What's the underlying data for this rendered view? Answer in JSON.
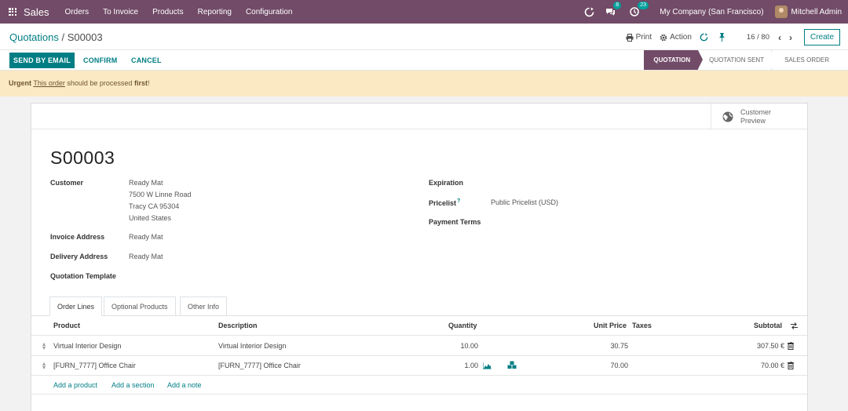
{
  "topbar": {
    "app_name": "Sales",
    "menu": [
      "Orders",
      "To Invoice",
      "Products",
      "Reporting",
      "Configuration"
    ],
    "messages_count": "8",
    "activities_count": "23",
    "company": "My Company (San Francisco)",
    "user": "Mitchell Admin"
  },
  "controlpanel": {
    "breadcrumb_parent": "Quotations",
    "breadcrumb_sep": "/",
    "breadcrumb_current": "S00003",
    "print_label": "Print",
    "action_label": "Action",
    "pager": "16 / 80",
    "create_label": "Create"
  },
  "statusbar": {
    "send_label": "SEND BY EMAIL",
    "confirm_label": "CONFIRM",
    "cancel_label": "CANCEL",
    "stages": [
      "QUOTATION",
      "QUOTATION SENT",
      "SALES ORDER"
    ],
    "active_stage": "QUOTATION"
  },
  "alert": {
    "prefix": "Urgent",
    "link": "This order",
    "middle": "should be processed",
    "emphasis": "first",
    "suffix": "!"
  },
  "sheet": {
    "customer_preview": [
      "Customer",
      "Preview"
    ],
    "title": "S00003",
    "fields": {
      "customer_label": "Customer",
      "customer_lines": [
        "Ready Mat",
        "7500 W Linne Road",
        "Tracy CA 95304",
        "United States"
      ],
      "invoice_label": "Invoice Address",
      "invoice_value": "Ready Mat",
      "delivery_label": "Delivery Address",
      "delivery_value": "Ready Mat",
      "template_label": "Quotation Template",
      "expiration_label": "Expiration",
      "pricelist_label": "Pricelist",
      "pricelist_help": "?",
      "pricelist_value": "Public Pricelist (USD)",
      "payment_terms_label": "Payment Terms"
    },
    "tabs": [
      "Order Lines",
      "Optional Products",
      "Other Info"
    ],
    "columns": [
      "Product",
      "Description",
      "Quantity",
      "Unit Price",
      "Taxes",
      "Subtotal"
    ],
    "lines": [
      {
        "product": "Virtual Interior Design",
        "description": "Virtual Interior Design",
        "quantity": "10.00",
        "unit_price": "30.75",
        "taxes": "",
        "subtotal": "307.50 €"
      },
      {
        "product": "[FURN_7777] Office Chair",
        "description": "[FURN_7777] Office Chair",
        "quantity": "1.00",
        "unit_price": "70.00",
        "taxes": "",
        "subtotal": "70.00 €"
      }
    ],
    "add_links": [
      "Add a product",
      "Add a section",
      "Add a note"
    ]
  },
  "colors": {
    "brand": "#714b67",
    "accent": "#017e84",
    "alert_bg": "#fbe9c4"
  }
}
